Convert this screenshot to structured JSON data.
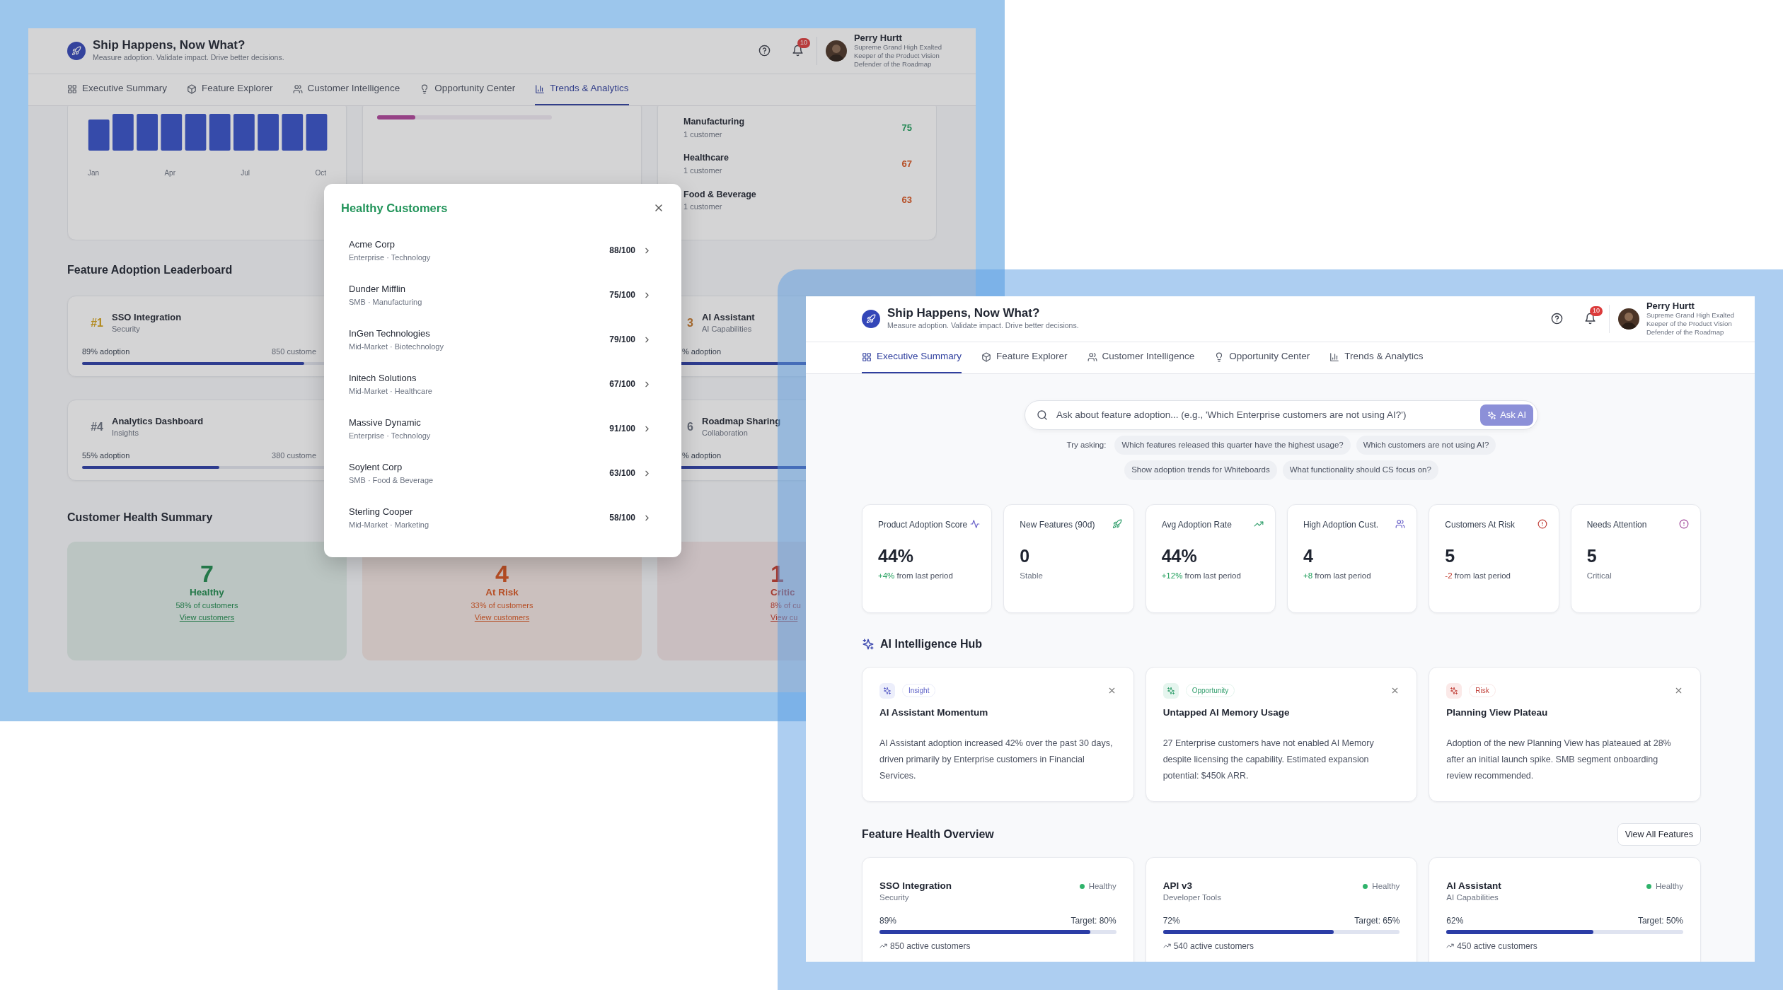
{
  "left_window": {
    "header": {
      "title": "Ship Happens, Now What?",
      "subtitle": "Measure adoption. Validate impact. Drive better decisions.",
      "notifications": "10",
      "user_name": "Perry Hurtt",
      "user_titles": [
        "Supreme Grand High Exalted",
        "Keeper of the Product Vision",
        "Defender of the Roadmap"
      ]
    },
    "tabs": [
      {
        "label": "Executive Summary",
        "selected": false
      },
      {
        "label": "Feature Explorer",
        "selected": false
      },
      {
        "label": "Customer Intelligence",
        "selected": false
      },
      {
        "label": "Opportunity Center",
        "selected": false
      },
      {
        "label": "Trends & Analytics",
        "selected": true
      }
    ],
    "trend_chart": {
      "axis_labels": [
        "Jan",
        "Apr",
        "Jul",
        "Oct"
      ]
    },
    "progress_card": {
      "level": 0.22
    },
    "industries": [
      {
        "name": "Manufacturing",
        "count": "1 customer",
        "score": "75",
        "kind": "good"
      },
      {
        "name": "Healthcare",
        "count": "1 customer",
        "score": "67",
        "kind": "fair"
      },
      {
        "name": "Food & Beverage",
        "count": "1 customer",
        "score": "63",
        "kind": "fair"
      }
    ],
    "leaderboard": {
      "title": "Feature Adoption Leaderboard",
      "rows": [
        {
          "left": {
            "rank": "#1",
            "name": "SSO Integration",
            "category": "Security",
            "adoption": "89% adoption",
            "customers": "850 custome",
            "level": 0.89,
            "kind": "gold"
          },
          "right": {
            "rank": "3",
            "name": "AI Assistant",
            "category": "AI Capabilities",
            "adoption": "% adoption",
            "level": 0.62,
            "kind": "bronze"
          }
        },
        {
          "left": {
            "rank": "#4",
            "name": "Analytics Dashboard",
            "category": "Insights",
            "adoption": "55% adoption",
            "customers": "380 custome",
            "level": 0.55,
            "kind": "plain"
          },
          "right": {
            "rank": "6",
            "name": "Roadmap Sharing",
            "category": "Collaboration",
            "adoption": "% adoption",
            "level": 0.6,
            "kind": "plain"
          }
        }
      ]
    },
    "health_summary": {
      "title": "Customer Health Summary",
      "cards": [
        {
          "count": "7",
          "label": "Healthy",
          "share": "58% of customers",
          "link": "View customers",
          "kind": "healthy"
        },
        {
          "count": "4",
          "label": "At Risk",
          "share": "33% of customers",
          "link": "View customers",
          "kind": "at_risk"
        },
        {
          "count": "1",
          "label": "Critic",
          "share": "8% of cu",
          "link": "View cu",
          "kind": "critical"
        }
      ]
    }
  },
  "modal": {
    "title": "Healthy Customers",
    "customers": [
      {
        "name": "Acme Corp",
        "segment": "Enterprise · Technology",
        "score": "88/100"
      },
      {
        "name": "Dunder Mifflin",
        "segment": "SMB · Manufacturing",
        "score": "75/100"
      },
      {
        "name": "InGen Technologies",
        "segment": "Mid-Market · Biotechnology",
        "score": "79/100"
      },
      {
        "name": "Initech Solutions",
        "segment": "Mid-Market · Healthcare",
        "score": "67/100"
      },
      {
        "name": "Massive Dynamic",
        "segment": "Enterprise · Technology",
        "score": "91/100"
      },
      {
        "name": "Soylent Corp",
        "segment": "SMB · Food & Beverage",
        "score": "63/100"
      },
      {
        "name": "Sterling Cooper",
        "segment": "Mid-Market · Marketing",
        "score": "58/100"
      }
    ]
  },
  "right_window": {
    "header": {
      "title": "Ship Happens, Now What?",
      "subtitle": "Measure adoption. Validate impact. Drive better decisions.",
      "notifications": "10",
      "user_name": "Perry Hurtt",
      "user_titles": [
        "Supreme Grand High Exalted",
        "Keeper of the Product Vision",
        "Defender of the Roadmap"
      ]
    },
    "tabs": [
      {
        "label": "Executive Summary",
        "selected": true
      },
      {
        "label": "Feature Explorer",
        "selected": false
      },
      {
        "label": "Customer Intelligence",
        "selected": false
      },
      {
        "label": "Opportunity Center",
        "selected": false
      },
      {
        "label": "Trends & Analytics",
        "selected": false
      }
    ],
    "search": {
      "placeholder": "Ask about feature adoption... (e.g., 'Which Enterprise customers are not using AI?')",
      "button": "Ask AI"
    },
    "suggestions": {
      "label": "Try asking:",
      "rows": [
        [
          "Which features released this quarter have the highest usage?",
          "Which customers are not using AI?"
        ],
        [
          "Show adoption trends for Whiteboards",
          "What functionality should CS focus on?"
        ]
      ]
    },
    "kpis": [
      {
        "kind": "rise",
        "label": "Product Adoption Score",
        "value": "44%",
        "delta": "+4%",
        "note": "from last period"
      },
      {
        "kind": "plain",
        "label": "New Features (90d)",
        "value": "0",
        "note": "Stable"
      },
      {
        "kind": "rise",
        "label": "Avg Adoption Rate",
        "value": "44%",
        "delta": "+12%",
        "note": "from last period"
      },
      {
        "kind": "rise",
        "label": "High Adoption Cust.",
        "value": "4",
        "delta": "+8",
        "note": "from last period"
      },
      {
        "kind": "fall",
        "label": "Customers At Risk",
        "value": "5",
        "delta": "-2",
        "note": "from last period"
      },
      {
        "kind": "plain",
        "label": "Needs Attention",
        "value": "5",
        "note": "Critical"
      }
    ],
    "ai_hub": {
      "title": "AI Intelligence Hub",
      "insights": [
        {
          "kind": "insight",
          "tag": "Insight",
          "title": "AI Assistant Momentum",
          "body": "AI Assistant adoption increased 42% over the past 30 days, driven primarily by Enterprise customers in Financial Services."
        },
        {
          "kind": "opportunity",
          "tag": "Opportunity",
          "title": "Untapped AI Memory Usage",
          "body": "27 Enterprise customers have not enabled AI Memory despite licensing the capability. Estimated expansion potential: $450k ARR."
        },
        {
          "kind": "risk",
          "tag": "Risk",
          "title": "Planning View Plateau",
          "body": "Adoption of the new Planning View has plateaued at 28% after an initial launch spike. SMB segment onboarding review recommended."
        }
      ]
    },
    "feature_health": {
      "title": "Feature Health Overview",
      "button": "View All Features",
      "features": [
        {
          "name": "SSO Integration",
          "category": "Security",
          "kind": "healthy",
          "status": "Healthy",
          "percent": "89%",
          "target": "Target: 80%",
          "level": 0.89,
          "customers": "850 active customers"
        },
        {
          "name": "API v3",
          "category": "Developer Tools",
          "kind": "healthy",
          "status": "Healthy",
          "percent": "72%",
          "target": "Target: 65%",
          "level": 0.72,
          "customers": "540 active customers"
        },
        {
          "name": "AI Assistant",
          "category": "AI Capabilities",
          "kind": "healthy",
          "status": "Healthy",
          "percent": "62%",
          "target": "Target: 50%",
          "level": 0.62,
          "customers": "450 active customers"
        }
      ]
    }
  }
}
